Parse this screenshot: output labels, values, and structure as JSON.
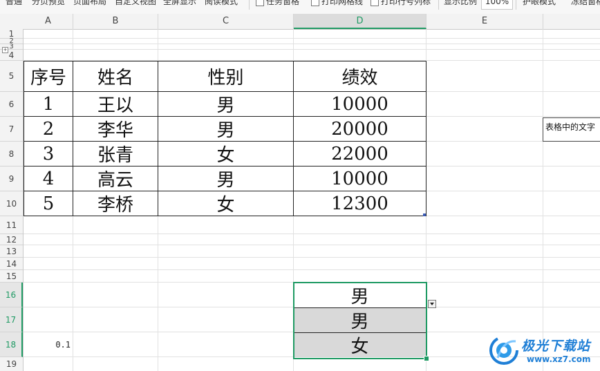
{
  "ribbon": {
    "items": [
      "普通",
      "分页预览",
      "页面布局",
      "自定义视图",
      "全屏显示",
      "阅读模式",
      "任务窗格",
      "打印网格线",
      "打印行号列标",
      "显示比例",
      "100%",
      "护眼模式",
      "冻结窗格"
    ]
  },
  "columns": [
    "A",
    "B",
    "C",
    "D",
    "E"
  ],
  "active_column": "D",
  "rows": [
    "1",
    "2",
    "3",
    "4",
    "5",
    "6",
    "7",
    "8",
    "9",
    "10",
    "11",
    "12",
    "13",
    "14",
    "15",
    "16",
    "17",
    "18",
    "19"
  ],
  "outline_toggle": "+",
  "table": {
    "headers": [
      "序号",
      "姓名",
      "性别",
      "绩效"
    ],
    "rows": [
      [
        "1",
        "王以",
        "男",
        "10000"
      ],
      [
        "2",
        "李华",
        "男",
        "20000"
      ],
      [
        "3",
        "张青",
        "女",
        "22000"
      ],
      [
        "4",
        "高云",
        "男",
        "10000"
      ],
      [
        "5",
        "李桥",
        "女",
        "12300"
      ]
    ]
  },
  "comment_text": "表格中的文字",
  "selection_cells": [
    "男",
    "男",
    "女"
  ],
  "cell_a18": "0.1",
  "watermark": {
    "name": "极光下载站",
    "url": "www.xz7.com"
  },
  "colors": {
    "selection": "#1e9a63",
    "watermark": "#1f7fd6"
  }
}
